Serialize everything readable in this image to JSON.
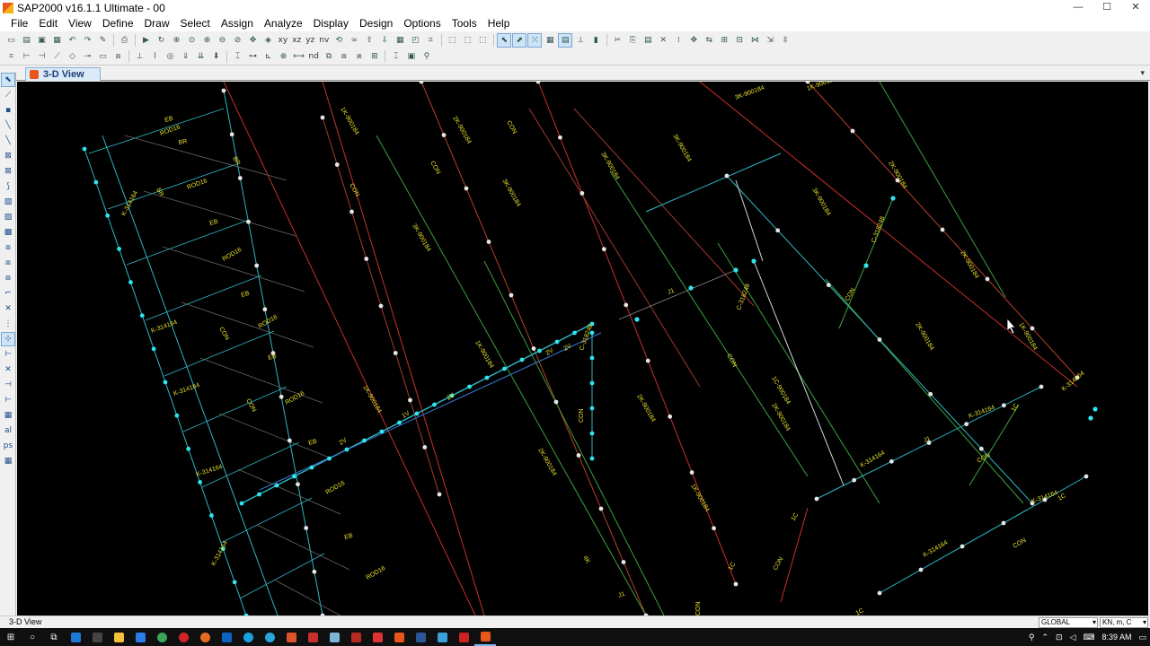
{
  "window": {
    "title": "SAP2000 v16.1.1 Ultimate  - 00",
    "min": "—",
    "max": "☐",
    "close": "✕"
  },
  "menu": [
    "File",
    "Edit",
    "View",
    "Define",
    "Draw",
    "Select",
    "Assign",
    "Analyze",
    "Display",
    "Design",
    "Options",
    "Tools",
    "Help"
  ],
  "toolbar1_text": {
    "xy": "xy",
    "xz": "xz",
    "yz": "yz",
    "nv": "nv"
  },
  "toolbar2_text": {
    "nd": "nd"
  },
  "tab": {
    "label": "3-D View",
    "dropdown": "▾"
  },
  "status": {
    "text": "3-D View",
    "coord_system": "GLOBAL",
    "units": "KN, m, C"
  },
  "taskbar": {
    "time": "8:39 AM"
  },
  "colors": {
    "canvas_bg": "#000000",
    "member_cyan": "#2fb7c4",
    "member_red": "#c9302c",
    "member_green": "#3aa23a",
    "member_white": "#d8d8d8",
    "joint_white": "#e6e6e6",
    "joint_cyan": "#2ee6f0",
    "label_yellow": "#e8e030"
  },
  "labels": {
    "k314164": "K-314164",
    "k900184": "1K-900184",
    "k2_900184": "2K-900184",
    "k3_900184": "3K-900184",
    "c318248": "C-318248",
    "c1_900184": "1C-900184",
    "con": "CON",
    "eb": "EB",
    "br": "BR",
    "rod16": "ROD16",
    "j1": "J1",
    "c1": "1C",
    "v2": "2V",
    "v1": "1V",
    "k4": "4K"
  }
}
